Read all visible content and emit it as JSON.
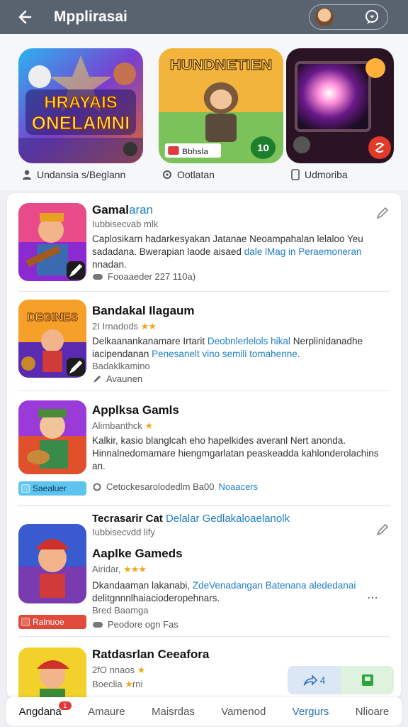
{
  "header": {
    "title": "Mpplirasai",
    "back_icon": "arrow-left-icon",
    "chat_icon": "chat-bubble-icon"
  },
  "featured": [
    {
      "label": "Undansia s/Beglann",
      "icon": "person-icon",
      "art_text_1": "HRAYAIS",
      "art_text_2": "ONELAMNI"
    },
    {
      "label": "Ootlatan",
      "icon": "gear-icon",
      "art_text_1": "HUNDNETIEN",
      "badge": "10",
      "tag": "Bbhsla"
    },
    {
      "label": "Udmoriba",
      "icon": "phone-icon"
    }
  ],
  "items": [
    {
      "title": "Gamal",
      "title_accent": "aran",
      "subtitle": "Iubbisecvab mlk",
      "desc": "Caplosikarn hadarkesyakan Jatanae Neoampahalan lelaloo Yeu sadadana. Bwerapian laode aisaed",
      "desc_link": "dale lMag in Peraemoneran",
      "desc_tail": "nnadan.",
      "meta": "Fooaaeder 227 110a)",
      "meta_icon": "controller-icon"
    },
    {
      "title": "Bandakal Ilagaum",
      "subtitle": "2I Irnadods",
      "stars": "★★",
      "desc": "Delkaanankanamare Irtarit",
      "desc_link": "Deobnlerlelols hikal",
      "desc_mid": "Nerplinidanadhe iacipendanan",
      "desc_link2": "Penesanelt vino semili tomahenne.",
      "meta_top": "Badaklkamino",
      "meta": "Avaunen",
      "meta_icon": "edit-icon"
    },
    {
      "title": "Applksa Gamls",
      "subtitle": "Alimbanthck",
      "stars": "★",
      "desc": "Kalkir, kasio blanglcah eho hapelkides averanl Nert anonda. Hinnalnedomamare hiengmgarlatan peaskeadda kahlonderolachins an.",
      "meta": "Cetockesarolodedlm Ba00",
      "meta_link": "Noaacers",
      "meta_icon": "gear-icon",
      "tag": "Saealuer"
    },
    {
      "pre_title": "Tecrasarir Cat",
      "pre_link": "Delalar Gedlakaloaelanolk",
      "pre_sub": "Iubbisecvdd lify",
      "title": "Aaplke Gameds",
      "subtitle": "Airidar,",
      "stars": "★★★",
      "desc": "Dkandaaman lakanabi,",
      "desc_link": "ZdeVenadangan Batenana alededanai",
      "desc_tail": "delitgnnnlhaiacioderopehnars.",
      "meta_top": "Bred Baamga",
      "meta": "Peodore ogn Fas",
      "meta_icon": "controller-icon",
      "tag": "Ralnuoe"
    },
    {
      "title": "Ratdasrlan Ceeafora",
      "subtitle": "2fO nnaos",
      "stars": "★",
      "meta_top": "Boeclia",
      "meta_stars": "★",
      "meta_tail": "rni"
    }
  ],
  "float_actions": {
    "share_count": "4",
    "share_icon": "share-icon",
    "save_icon": "bookmark-icon"
  },
  "bottom_nav": [
    {
      "label": "Angdana",
      "badge": "1"
    },
    {
      "label": "Amaure"
    },
    {
      "label": "Maisrdas"
    },
    {
      "label": "Vamenod"
    },
    {
      "label": "Vergurs"
    },
    {
      "label": "Nlioare"
    }
  ]
}
